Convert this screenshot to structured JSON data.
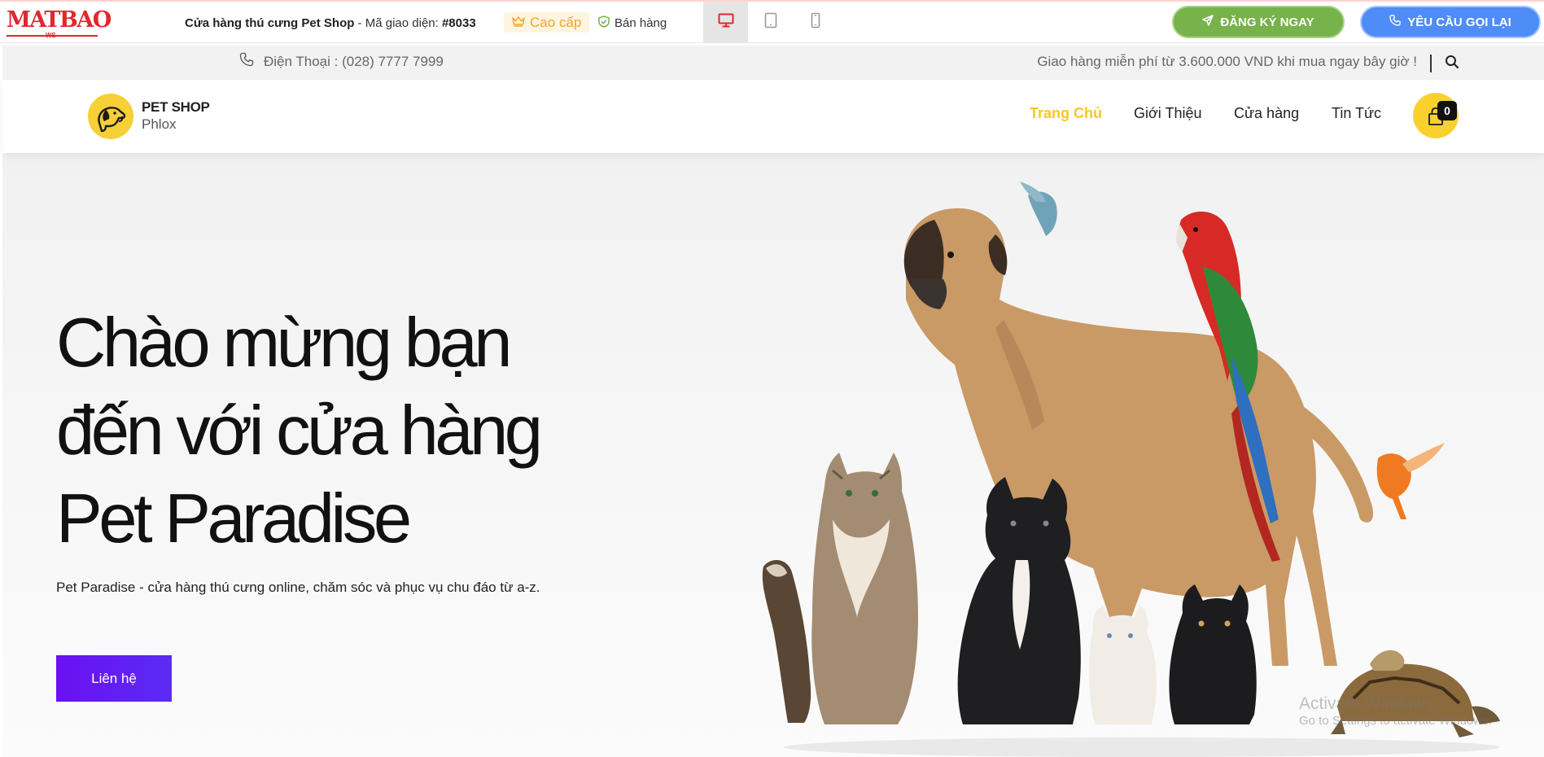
{
  "demo_bar": {
    "brand_word": "MATBAO",
    "brand_sub": "WS",
    "title_prefix": "Cửa hàng thú cưng Pet Shop",
    "title_sep": " - ",
    "code_label": "Mã giao diện: ",
    "code_value": "#8033",
    "badge_premium": "Cao cấp",
    "badge_sales": "Bán hàng",
    "register_button": "ĐĂNG KÝ NGAY",
    "callback_button": "YÊU CẦU GỌI LẠI"
  },
  "info_bar": {
    "phone": "Điện Thoại : (028) 7777 7999",
    "shipping": "Giao hàng miễn phí từ 3.600.000 VND khi mua ngay bây giờ !"
  },
  "header": {
    "logo_title": "PET SHOP",
    "logo_subtitle": "Phlox",
    "nav": [
      "Trang Chủ",
      "Giới Thiệu",
      "Cửa hàng",
      "Tin Tức"
    ],
    "cart_count": "0"
  },
  "hero": {
    "title_lines": [
      "Chào mừng bạn",
      "đến với cửa hàng",
      "Pet Paradise"
    ],
    "description": "Pet Paradise - cửa hàng thú cưng online, chăm sóc và phục vụ chu đáo từ a-z.",
    "cta": "Liên hệ"
  },
  "os_overlay": {
    "line1": "Activate Windows",
    "line2": "Go to Settings to activate Windows."
  },
  "colors": {
    "accent": "#f7c72b",
    "brand_red": "#e3262f",
    "register_green": "#77b24a",
    "callback_blue": "#4e8cf7",
    "cta_purple": "#6a11f1"
  }
}
